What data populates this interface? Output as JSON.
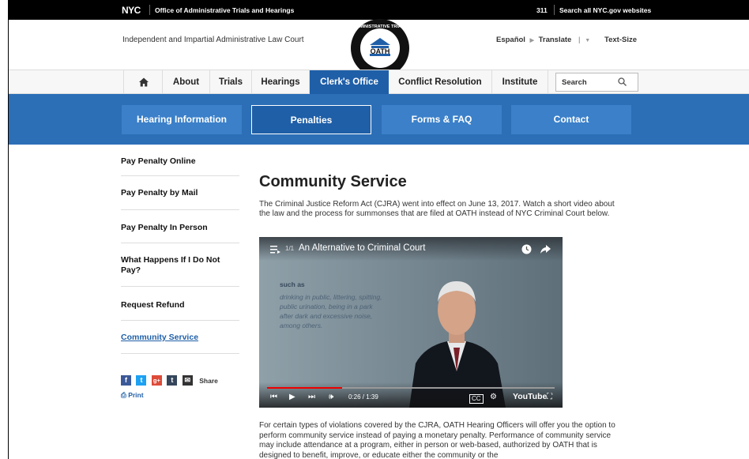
{
  "topbar": {
    "logo": "NYC",
    "agency": "Office of Administrative Trials and Hearings",
    "n311": "311",
    "search_all": "Search all NYC.gov websites"
  },
  "header": {
    "tagline": "Independent and Impartial Administrative Law Court",
    "seal_text": "OATH",
    "espanol": "Español",
    "translate": "Translate",
    "text_size": "Text-Size"
  },
  "nav": {
    "items": [
      "About",
      "Trials",
      "Hearings",
      "Clerk's Office",
      "Conflict Resolution",
      "Institute"
    ],
    "active": "Clerk's Office",
    "search_placeholder": "Search"
  },
  "subnav": {
    "items": [
      "Hearing Information",
      "Penalties",
      "Forms & FAQ",
      "Contact"
    ],
    "selected": "Penalties"
  },
  "sidebar": {
    "items": [
      "Pay Penalty Online",
      "Pay Penalty by Mail",
      "Pay Penalty In Person",
      "What Happens If I Do Not Pay?",
      "Request Refund",
      "Community Service"
    ],
    "current": "Community Service",
    "share_label": "Share",
    "print_label": "Print"
  },
  "content": {
    "title": "Community Service",
    "intro": "The Criminal Justice Reform Act (CJRA) went into effect on June 13, 2017. Watch a short video about the law and the process for summonses that are filed at OATH instead of NYC Criminal Court below.",
    "video": {
      "title": "An Alternative to Criminal Court",
      "playlist_count": "1/1",
      "overlay_heading": "such as",
      "overlay_lines": [
        "drinking in public, littering, spitting,",
        "public urination, being in a park",
        "after dark and excessive noise,",
        "among others."
      ],
      "time": "0:26 / 1:39",
      "progress": 0.26,
      "brand": "YouTube"
    },
    "body": "For certain types of violations covered by the CJRA, OATH Hearing Officers will offer you the option to perform community service instead of paying a monetary penalty. Performance of community service may include attendance at a program, either in person or web-based, authorized by OATH that is designed to benefit, improve, or educate either the community or the"
  },
  "colors": {
    "primary": "#1f5fa8",
    "band": "#2c6fb7",
    "button": "#3b80c9"
  }
}
